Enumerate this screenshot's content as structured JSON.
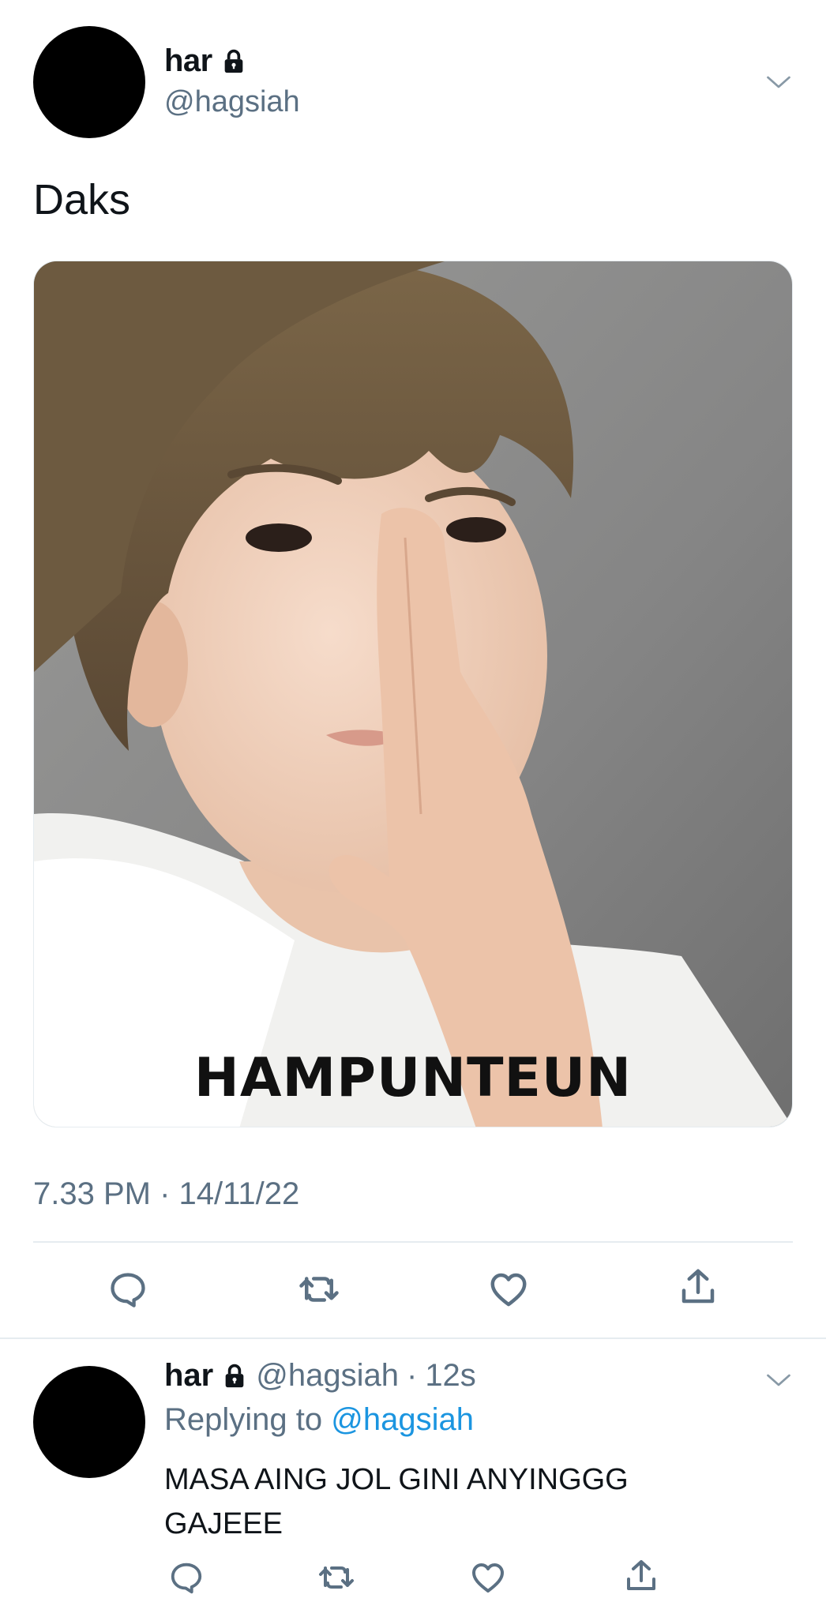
{
  "tweet": {
    "author": {
      "name": "har",
      "handle": "@hagsiah",
      "protected_icon": "lock-icon",
      "avatar_color": "#000000"
    },
    "text": "Daks",
    "media": {
      "caption": "HAMPUNTEUN"
    },
    "timestamp": "7.33 PM · 14/11/22",
    "actions": [
      "reply-icon",
      "retweet-icon",
      "like-icon",
      "share-icon"
    ]
  },
  "reply": {
    "author": {
      "name": "har",
      "handle": "@hagsiah",
      "separator": "·",
      "time": "12s"
    },
    "replying_prefix": "Replying to",
    "replying_to": "@hagsiah",
    "text": "MASA AING JOL GINI ANYINGGG GAJEEE",
    "actions": [
      "reply-icon",
      "retweet-icon",
      "like-icon",
      "share-icon"
    ]
  },
  "colors": {
    "text_primary": "#0f1419",
    "text_secondary": "#5b7083",
    "link": "#1b95e0",
    "divider": "#e6ecf0"
  }
}
